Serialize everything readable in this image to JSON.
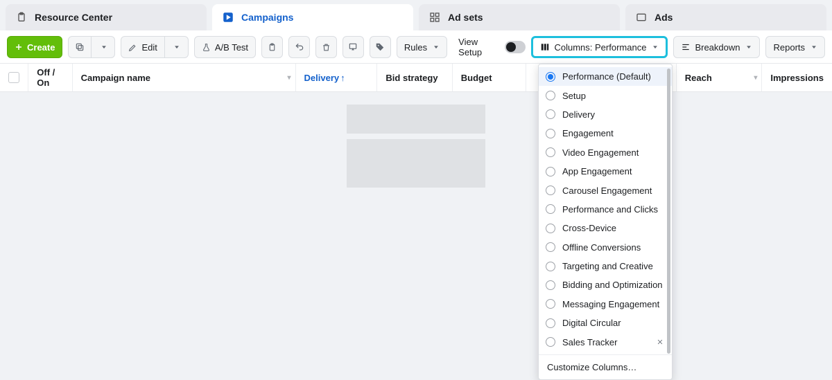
{
  "tabs": {
    "resource_center": "Resource Center",
    "campaigns": "Campaigns",
    "ad_sets": "Ad sets",
    "ads": "Ads"
  },
  "toolbar": {
    "create": "Create",
    "edit": "Edit",
    "ab_test": "A/B Test",
    "rules": "Rules",
    "view_setup": "View Setup",
    "columns": "Columns: Performance",
    "breakdown": "Breakdown",
    "reports": "Reports"
  },
  "columns_header": {
    "off_on": "Off / On",
    "campaign_name": "Campaign name",
    "delivery": "Delivery",
    "bid": "Bid strategy",
    "budget": "Budget",
    "reach": "Reach",
    "impressions": "Impressions"
  },
  "columns_menu": {
    "items": [
      "Performance (Default)",
      "Setup",
      "Delivery",
      "Engagement",
      "Video Engagement",
      "App Engagement",
      "Carousel Engagement",
      "Performance and Clicks",
      "Cross-Device",
      "Offline Conversions",
      "Targeting and Creative",
      "Bidding and Optimization",
      "Messaging Engagement",
      "Digital Circular",
      "Sales Tracker"
    ],
    "selected_index": 0,
    "removable_index": 14,
    "customize": "Customize Columns…"
  }
}
